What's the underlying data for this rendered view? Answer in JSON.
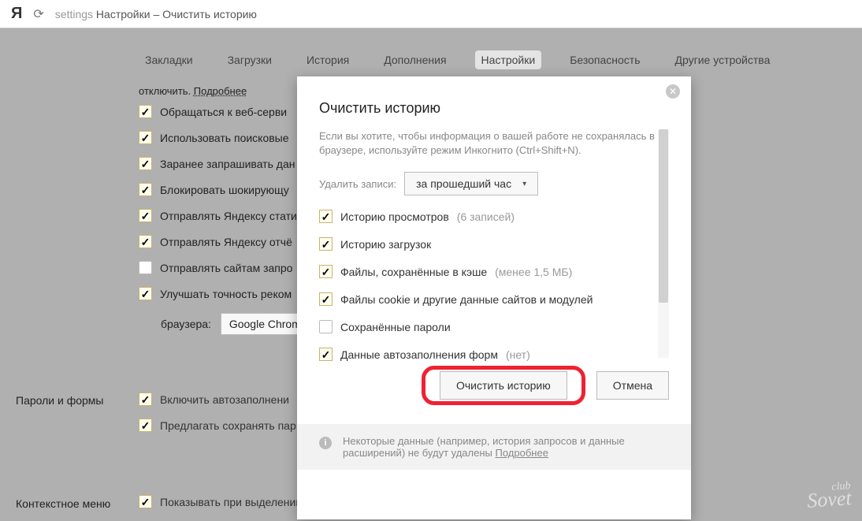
{
  "address": {
    "path": "settings",
    "title": "Настройки – Очистить историю"
  },
  "tabs": [
    "Закладки",
    "Загрузки",
    "История",
    "Дополнения",
    "Настройки",
    "Безопасность",
    "Другие устройства"
  ],
  "active_tab": 4,
  "bg": {
    "hint_prefix": "отключить.",
    "hint_link": "Подробнее",
    "items": [
      {
        "checked": true,
        "label": "Обращаться к веб-серви"
      },
      {
        "checked": true,
        "label": "Использовать поисковые"
      },
      {
        "checked": true,
        "label": "Заранее запрашивать дан"
      },
      {
        "checked": true,
        "label": "Блокировать шокирующу"
      },
      {
        "checked": true,
        "label": "Отправлять Яндексу стати"
      },
      {
        "checked": true,
        "label": "Отправлять Яндексу отчё"
      },
      {
        "checked": false,
        "label": "Отправлять сайтам запро"
      },
      {
        "checked": true,
        "label": "Улучшать точность реком"
      }
    ],
    "from_label": "браузера:",
    "from_select": "Google Chrom"
  },
  "sections": {
    "passwords": "Пароли и формы",
    "context": "Контекстное меню",
    "p_items": [
      {
        "checked": true,
        "label": "Включить автозаполнени"
      },
      {
        "checked": true,
        "label": "Предлагать сохранять пар"
      }
    ],
    "c_item": {
      "checked": true,
      "label": "Показывать при выделении текста кнопки «Найти» и «Копировать»"
    }
  },
  "dialog": {
    "title": "Очистить историю",
    "hint": "Если вы хотите, чтобы информация о вашей работе не сохранялась в браузере, используйте режим Инкогнито (Ctrl+Shift+N).",
    "delete_label": "Удалить записи:",
    "period": "за прошедший час",
    "options": [
      {
        "checked": true,
        "label": "Историю просмотров",
        "note": "(6 записей)"
      },
      {
        "checked": true,
        "label": "Историю загрузок",
        "note": ""
      },
      {
        "checked": true,
        "label": "Файлы, сохранённые в кэше",
        "note": "(менее 1,5 МБ)"
      },
      {
        "checked": true,
        "label": "Файлы cookie и другие данные сайтов и модулей",
        "note": ""
      },
      {
        "checked": false,
        "label": "Сохранённые пароли",
        "note": ""
      },
      {
        "checked": true,
        "label": "Данные автозаполнения форм",
        "note": "(нет)"
      }
    ],
    "primary": "Очистить историю",
    "cancel": "Отмена",
    "footer": "Некоторые данные (например, история запросов и данные расширений) не будут удалены",
    "footer_link": "Подробнее"
  },
  "watermark": {
    "line1": "club",
    "line2": "Sovet"
  }
}
